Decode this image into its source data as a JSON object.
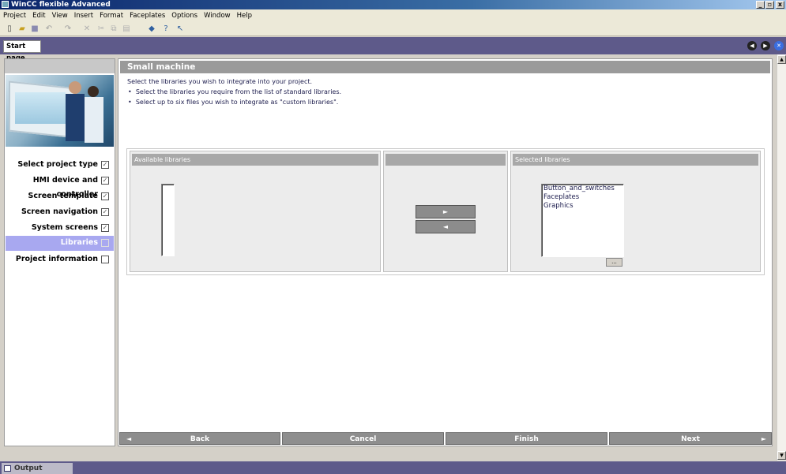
{
  "window": {
    "title": "WinCC flexible Advanced"
  },
  "menu": [
    "Project",
    "Edit",
    "View",
    "Insert",
    "Format",
    "Faceplates",
    "Options",
    "Window",
    "Help"
  ],
  "toolbar_icons": [
    "new-icon",
    "open-icon",
    "save-icon",
    "undo-icon",
    "redo-icon",
    "delete-icon",
    "cut-icon",
    "copy-icon",
    "paste-icon",
    "compile-icon",
    "help-icon",
    "whats-this-icon"
  ],
  "tabs": {
    "start_page": "Start page"
  },
  "wizard": {
    "steps": [
      {
        "label": "Select project type",
        "checked": true
      },
      {
        "label": "HMI device and controller",
        "checked": true
      },
      {
        "label": "Screen template",
        "checked": true
      },
      {
        "label": "Screen navigation",
        "checked": true
      },
      {
        "label": "System screens",
        "checked": true
      },
      {
        "label": "Libraries",
        "checked": false,
        "active": true
      },
      {
        "label": "Project information",
        "checked": false
      }
    ],
    "header": "Small machine",
    "intro": "Select the libraries you wish to integrate into your project.",
    "bullets": [
      "Select the libraries you require from the list of standard libraries.",
      "Select up to six files you wish to integrate as \"custom libraries\"."
    ],
    "available_header": "Available libraries",
    "selected_header": "Selected libraries",
    "available_items": [],
    "selected_items": [
      "Button_and_switches",
      "Faceplates",
      "Graphics"
    ],
    "move_right": "►",
    "move_left": "◄",
    "ellipsis": "...",
    "buttons": {
      "back": "Back",
      "cancel": "Cancel",
      "finish": "Finish",
      "next": "Next"
    }
  },
  "output": {
    "label": "Output"
  },
  "colors": {
    "accent": "#5e5a8a",
    "active_step": "#a8a8f0",
    "header_gray": "#9a9a9a"
  }
}
